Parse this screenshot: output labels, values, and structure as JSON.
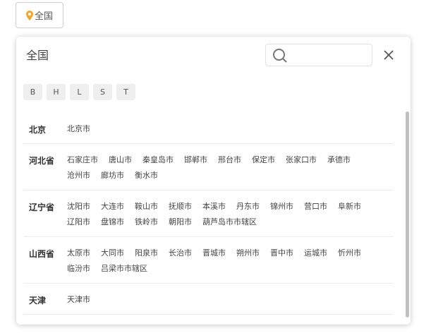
{
  "trigger": {
    "label": "全国"
  },
  "panel": {
    "title": "全国",
    "search_placeholder": "",
    "letters": [
      "B",
      "H",
      "L",
      "S",
      "T"
    ]
  },
  "provinces": [
    {
      "name": "北京",
      "cities": [
        "北京市"
      ]
    },
    {
      "name": "河北省",
      "cities": [
        "石家庄市",
        "唐山市",
        "秦皇岛市",
        "邯郸市",
        "邢台市",
        "保定市",
        "张家口市",
        "承德市",
        "沧州市",
        "廊坊市",
        "衡水市"
      ]
    },
    {
      "name": "辽宁省",
      "cities": [
        "沈阳市",
        "大连市",
        "鞍山市",
        "抚顺市",
        "本溪市",
        "丹东市",
        "锦州市",
        "营口市",
        "阜新市",
        "辽阳市",
        "盘锦市",
        "铁岭市",
        "朝阳市",
        "葫芦岛市市辖区"
      ]
    },
    {
      "name": "山西省",
      "cities": [
        "太原市",
        "大同市",
        "阳泉市",
        "长治市",
        "晋城市",
        "朔州市",
        "晋中市",
        "运城市",
        "忻州市",
        "临汾市",
        "吕梁市市辖区"
      ]
    },
    {
      "name": "天津",
      "cities": [
        "天津市"
      ]
    }
  ],
  "colors": {
    "accent": "#f5a623"
  }
}
